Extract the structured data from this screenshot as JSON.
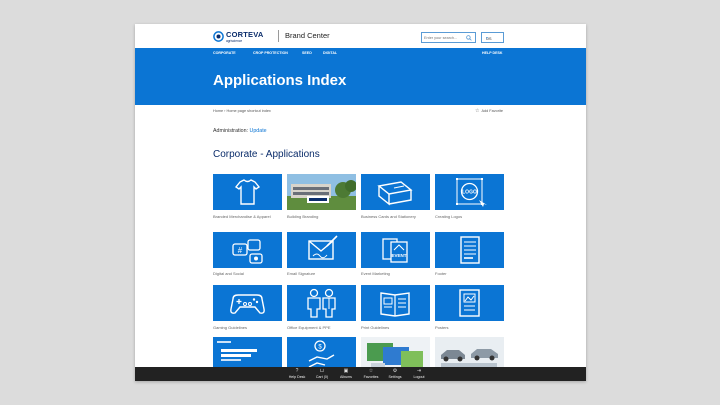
{
  "header": {
    "logo_text": "CORTEVA",
    "logo_sub": "agriscience",
    "site_title": "Brand Center",
    "search_placeholder": "Enter your search...",
    "language": "US"
  },
  "nav": {
    "items": [
      "CORPORATE",
      "CROP PROTECTION",
      "SEED",
      "DIGITAL"
    ],
    "help": "HELP DESK"
  },
  "hero": {
    "title": "Applications Index"
  },
  "breadcrumb": "Home › Home page shortcut index",
  "favorite": "Add Favorite",
  "admin": {
    "label": "Administration:",
    "link": "Update"
  },
  "section_title": "Corporate - Applications",
  "tiles": [
    {
      "label": "Branded Merchandise & Apparel",
      "icon": "tshirt-icon"
    },
    {
      "label": "Building Branding",
      "icon": "building-photo"
    },
    {
      "label": "Business Cards and Stationery",
      "icon": "business-cards-icon"
    },
    {
      "label": "Creating Logos",
      "icon": "logo-design-icon"
    },
    {
      "label": "Digital and Social",
      "icon": "social-media-icon"
    },
    {
      "label": "Email Signature",
      "icon": "email-signature-icon"
    },
    {
      "label": "Event Marketing",
      "icon": "event-icon"
    },
    {
      "label": "Footer",
      "icon": "document-icon"
    },
    {
      "label": "Gaming Guidelines",
      "icon": "gamepad-icon"
    },
    {
      "label": "Office Equipment & PPE",
      "icon": "ppe-icon"
    },
    {
      "label": "Print Guidelines",
      "icon": "brochure-icon"
    },
    {
      "label": "Posters",
      "icon": "poster-icon"
    },
    {
      "label": "",
      "icon": "presentation-thumbnail"
    },
    {
      "label": "",
      "icon": "payment-icon"
    },
    {
      "label": "",
      "icon": "screens-thumbnail"
    },
    {
      "label": "",
      "icon": "vehicles-photo"
    }
  ],
  "footer": {
    "items": [
      {
        "label": "Help Desk",
        "icon": "help-icon"
      },
      {
        "label": "Cart (0)",
        "icon": "cart-icon"
      },
      {
        "label": "Albums",
        "icon": "albums-icon"
      },
      {
        "label": "Favorites",
        "icon": "star-icon"
      },
      {
        "label": "Settings",
        "icon": "gear-icon"
      },
      {
        "label": "Logout",
        "icon": "logout-icon"
      }
    ]
  },
  "colors": {
    "brand_blue": "#0b75d4",
    "navy": "#0b2d6b",
    "footer": "#222222"
  }
}
